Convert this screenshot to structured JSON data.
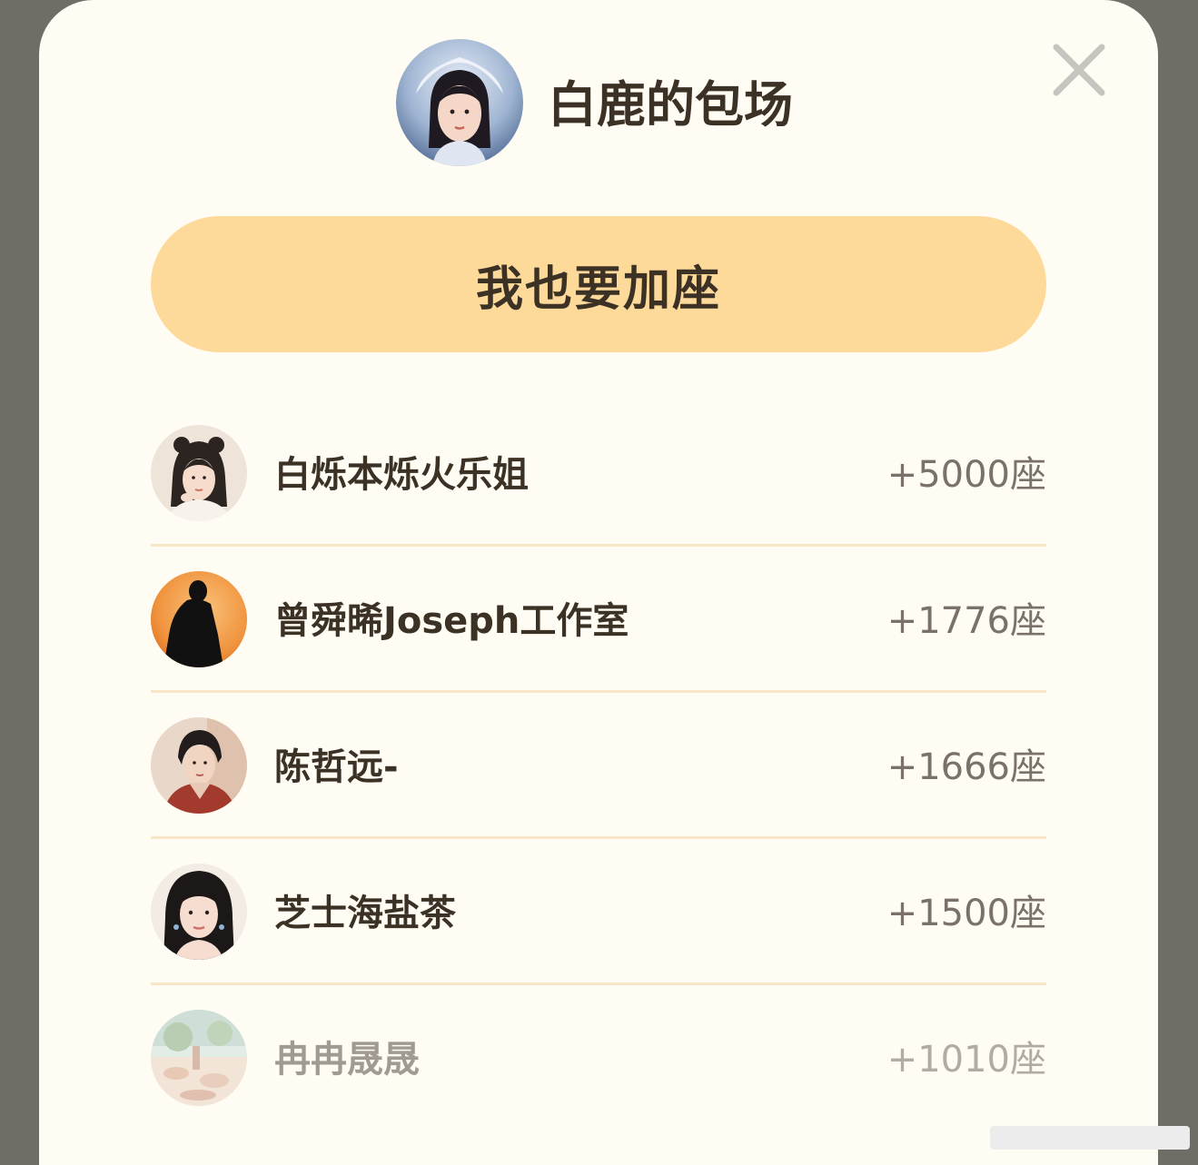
{
  "header": {
    "title": "白鹿的包场",
    "avatar_icon": "portrait-icon"
  },
  "close_icon": "close-icon",
  "join_button": {
    "label": "我也要加座"
  },
  "colors": {
    "sheet_background": "#fffdf3",
    "button_background": "#fdd99a",
    "divider": "#f8e7c6",
    "title_text": "#3c3125",
    "count_text": "#7a7268",
    "backdrop": "#6e6d66"
  },
  "contributors": [
    {
      "name": "白烁本烁火乐姐",
      "count": "+5000座",
      "avatar_icon": "portrait-icon"
    },
    {
      "name": "曾舜晞Joseph工作室",
      "count": "+1776座",
      "avatar_icon": "silhouette-icon"
    },
    {
      "name": "陈哲远-",
      "count": "+1666座",
      "avatar_icon": "portrait-icon"
    },
    {
      "name": "芝士海盐茶",
      "count": "+1500座",
      "avatar_icon": "portrait-icon"
    },
    {
      "name": "冉冉晟晟",
      "count": "+1010座",
      "avatar_icon": "scenery-icon"
    }
  ]
}
